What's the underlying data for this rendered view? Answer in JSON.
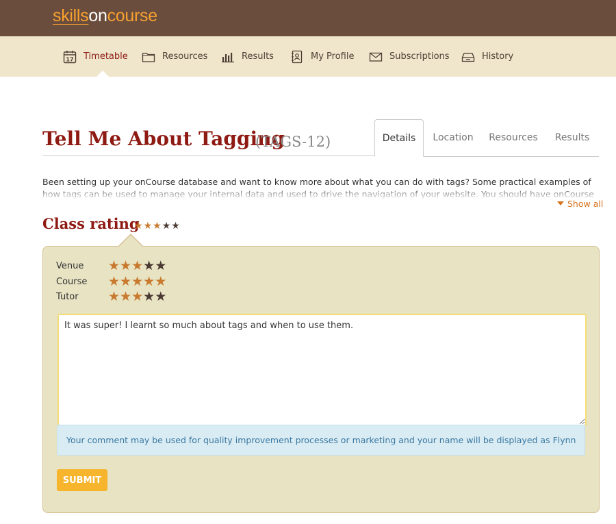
{
  "logo": {
    "part1": "skills",
    "part2": "on",
    "part3": "course"
  },
  "nav": [
    {
      "label": "Timetable",
      "icon": "calendar-icon",
      "active": true
    },
    {
      "label": "Resources",
      "icon": "folder-icon",
      "active": false
    },
    {
      "label": "Results",
      "icon": "bar-chart-icon",
      "active": false
    },
    {
      "label": "My Profile",
      "icon": "address-book-icon",
      "active": false
    },
    {
      "label": "Subscriptions",
      "icon": "envelope-icon",
      "active": false
    },
    {
      "label": "History",
      "icon": "archive-icon",
      "active": false
    }
  ],
  "course": {
    "title": "Tell Me About Tagging",
    "code": "(TAGS-12)"
  },
  "tabs": [
    {
      "label": "Details",
      "active": true
    },
    {
      "label": "Location",
      "active": false
    },
    {
      "label": "Resources",
      "active": false
    },
    {
      "label": "Results",
      "active": false
    }
  ],
  "description": "Been setting up your onCourse database and want to know more about what you can do with tags? Some practical examples of how tags can be used to manage your internal data and used to drive the navigation of your website. You should have onCourse installed, with your courses.",
  "show_all": "Show all",
  "class_rating": {
    "title": "Class rating",
    "overall": 3,
    "max": 5
  },
  "ratings": [
    {
      "label": "Venue",
      "value": 3
    },
    {
      "label": "Course",
      "value": 5
    },
    {
      "label": "Tutor",
      "value": 3
    }
  ],
  "comment": {
    "value": "It was super! I learnt so much about tags and when to use them."
  },
  "notice": "Your comment may be used for quality improvement processes or marketing and your name will be displayed as Flynn",
  "submit_label": "SUBMIT",
  "colors": {
    "header": "#6b4d3d",
    "nav": "#efe6cc",
    "accent": "#8e1b13",
    "orange": "#f7a130",
    "star_on": "#c8792e",
    "star_off": "#4b3a33",
    "panel": "#e7e3c3",
    "submit": "#f7b52e"
  }
}
